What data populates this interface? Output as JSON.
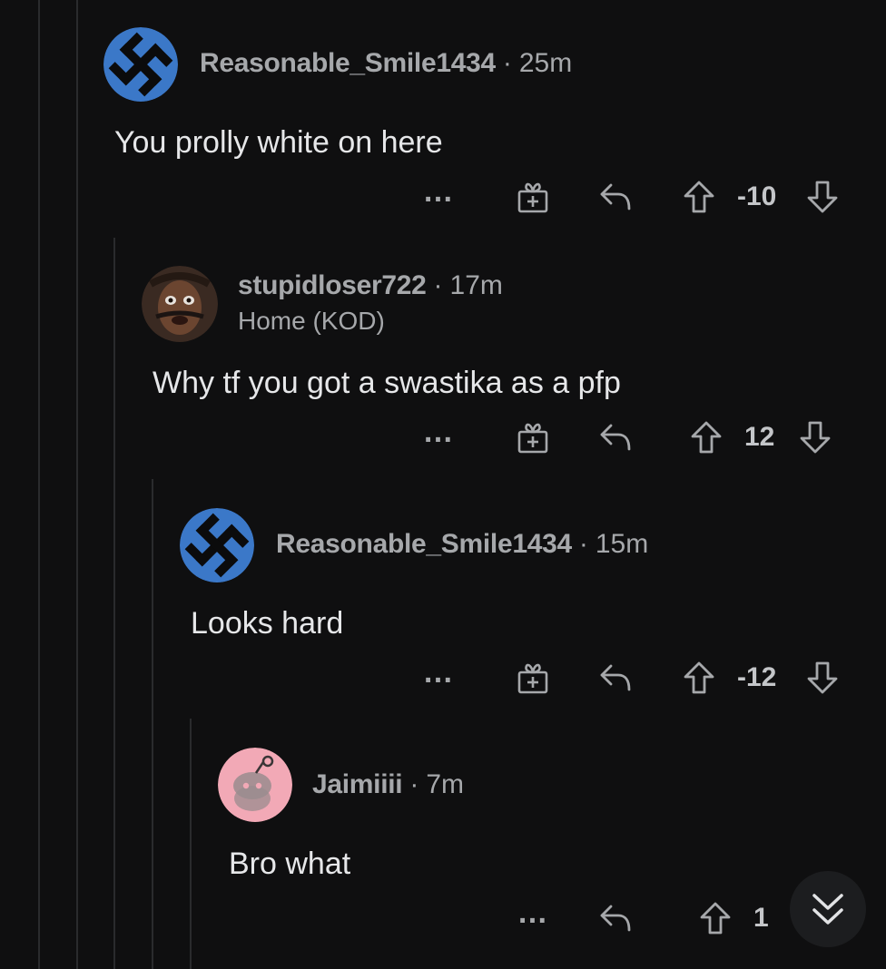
{
  "comments": [
    {
      "username": "Reasonable_Smile1434",
      "separator": "·",
      "age": "25m",
      "flair": "",
      "body": "You prolly white on here",
      "score": "-10",
      "avatar": "swastika-avatar",
      "has_award": true
    },
    {
      "username": "stupidloser722",
      "separator": "·",
      "age": "17m",
      "flair": "Home (KOD)",
      "body": "Why tf you got a swastika as a pfp",
      "score": "12",
      "avatar": "photo-avatar",
      "has_award": true
    },
    {
      "username": "Reasonable_Smile1434",
      "separator": "·",
      "age": "15m",
      "flair": "",
      "body": "Looks hard",
      "score": "-12",
      "avatar": "swastika-avatar",
      "has_award": true
    },
    {
      "username": "Jaimiiii",
      "separator": "·",
      "age": "7m",
      "flair": "",
      "body": "Bro what",
      "score": "1",
      "avatar": "snoo-avatar",
      "has_award": false
    }
  ],
  "icons": {
    "more": "…",
    "award": "gift-plus-icon",
    "reply": "reply-arrow-icon",
    "upvote": "upvote-arrow-icon",
    "downvote": "downvote-arrow-icon",
    "scroll": "double-chevron-down-icon"
  },
  "colors": {
    "background": "#0f0f10",
    "text": "#e6e7e9",
    "meta": "#a6a8ab",
    "avatar_blue": "#3b78c8",
    "avatar_pink": "#f2a9b6"
  }
}
